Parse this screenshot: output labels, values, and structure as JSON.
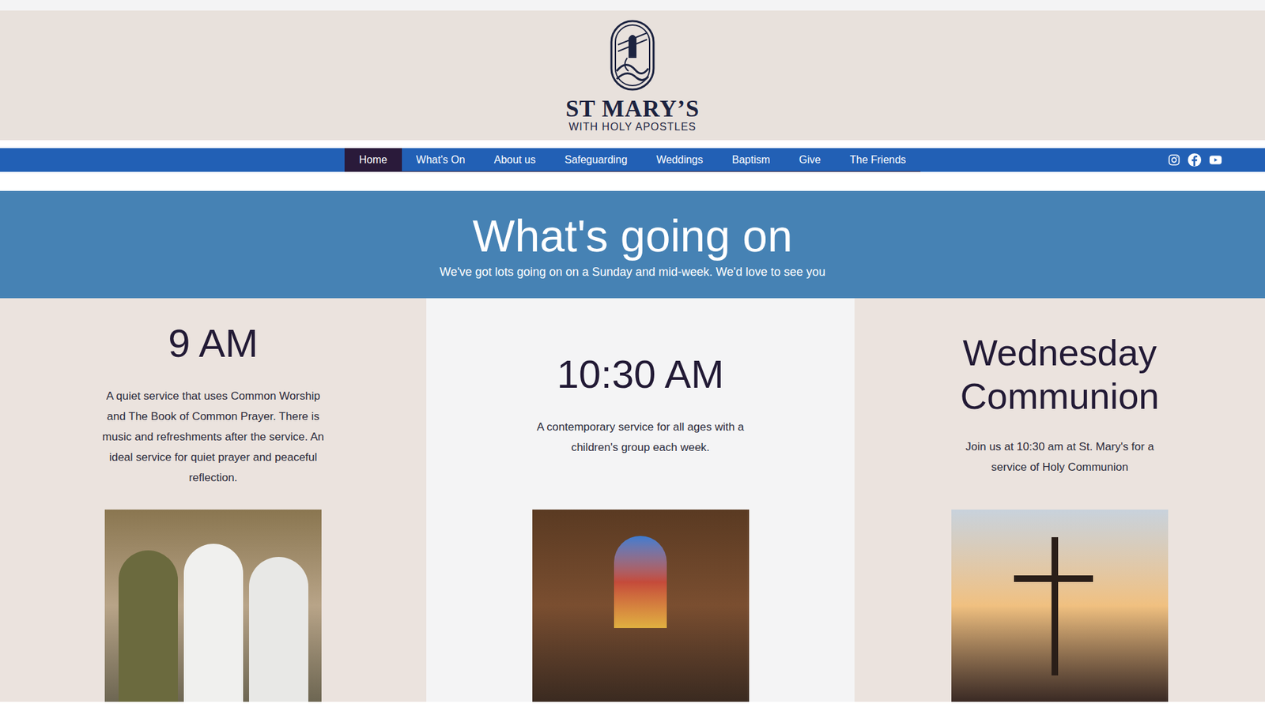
{
  "logo": {
    "name": "ST MARY’S",
    "subtitle": "WITH HOLY APOSTLES"
  },
  "nav": [
    {
      "label": "Home",
      "selected": true
    },
    {
      "label": "What's On",
      "selected": false
    },
    {
      "label": "About us",
      "selected": false
    },
    {
      "label": "Safeguarding",
      "selected": false
    },
    {
      "label": "Weddings",
      "selected": false
    },
    {
      "label": "Baptism",
      "selected": false
    },
    {
      "label": "Give",
      "selected": false
    },
    {
      "label": "The Friends",
      "selected": false
    }
  ],
  "banner": {
    "title": "What's going on",
    "subtitle": "We've got lots going on on a Sunday and mid-week. We'd love to see you"
  },
  "columns": [
    {
      "title": "9 AM",
      "text": "A quiet service that uses Common Worship and The Book of Common Prayer. There is music and refreshments after the service. An ideal service for quiet prayer and peaceful reflection.",
      "kind": "people"
    },
    {
      "title": "10:30 AM",
      "text": "A contemporary service for all ages with a children's group each week.",
      "kind": "church"
    },
    {
      "title": "Wednesday Communion",
      "text": "Join us at 10:30 am at St. Mary's for a service of Holy Communion",
      "kind": "cross"
    }
  ]
}
